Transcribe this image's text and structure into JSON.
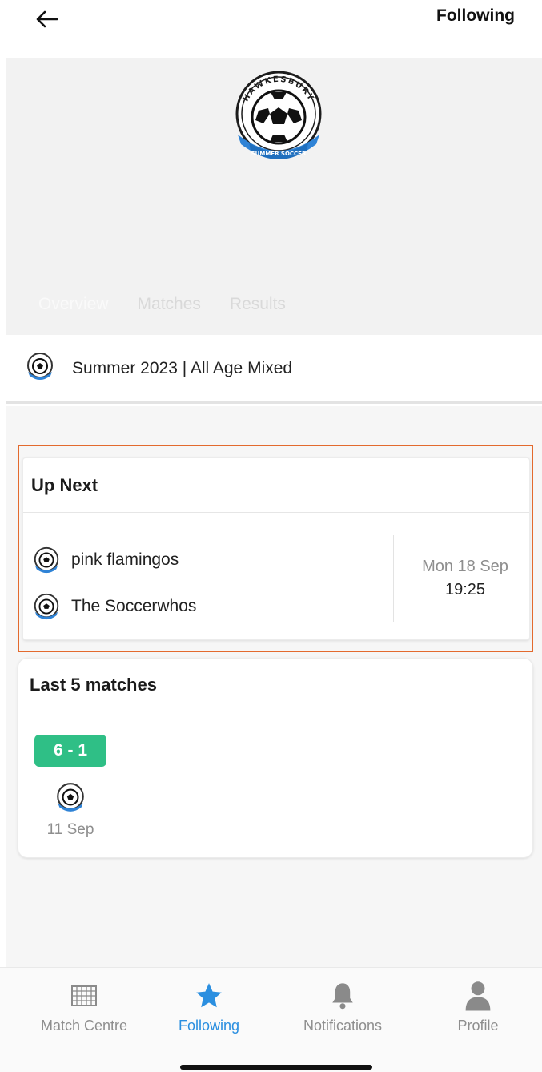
{
  "header": {
    "back_icon": "arrow-left-icon",
    "follow_label": "Following"
  },
  "hero": {
    "logo_icon": "soccer-club-crest",
    "logo_ring_text": "HAWKESBURY",
    "logo_banner_text": "SUMMER SOCCER",
    "title": "",
    "tabs": [
      {
        "label": "Overview",
        "active": true
      },
      {
        "label": "Matches",
        "active": false
      },
      {
        "label": "Results",
        "active": false
      }
    ]
  },
  "competition": {
    "label": "Summer 2023 | All Age Mixed",
    "icon": "club-badge-icon"
  },
  "up_next": {
    "title": "Up Next",
    "home_team": "pink flamingos",
    "away_team": "The Soccerwhos",
    "date": "Mon 18 Sep",
    "time": "19:25"
  },
  "last_matches": {
    "title": "Last 5 matches",
    "results": [
      {
        "score": "6 - 1",
        "date": "11 Sep",
        "result_color": "#2fbf86"
      }
    ]
  },
  "bottom_nav": {
    "items": [
      {
        "label": "Match Centre",
        "icon": "grid-icon",
        "active": false
      },
      {
        "label": "Following",
        "icon": "star-icon",
        "active": true
      },
      {
        "label": "Notifications",
        "icon": "bell-icon",
        "active": false
      },
      {
        "label": "Profile",
        "icon": "person-icon",
        "active": false
      }
    ]
  },
  "colors": {
    "accent": "#2b8fe0",
    "win": "#2fbf86",
    "highlight": "#e36a2e"
  }
}
